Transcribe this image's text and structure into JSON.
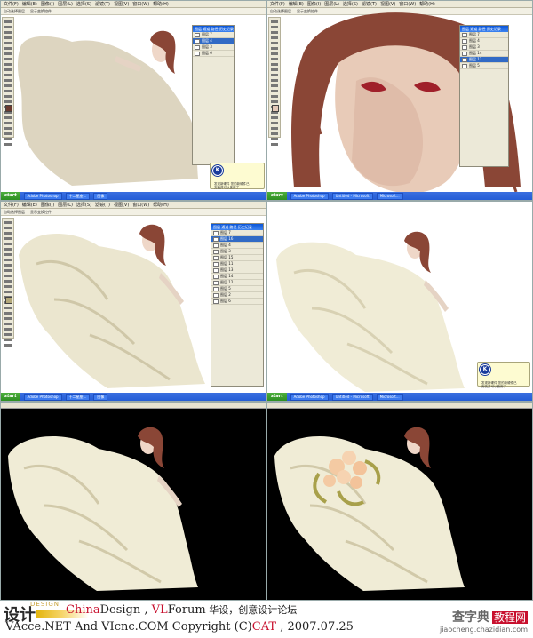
{
  "menus": [
    "文件(F)",
    "编辑(E)",
    "图像(I)",
    "图层(L)",
    "选择(S)",
    "滤镜(T)",
    "视图(V)",
    "窗口(W)",
    "帮助(H)"
  ],
  "options": [
    "自动选择图层",
    "显示变换控件"
  ],
  "taskbar": {
    "start": "start",
    "tasks_a": [
      "Adobe Photoshop",
      "十二星座...",
      "图像"
    ],
    "tasks_b": [
      "Adobe Photoshop",
      "Untitled - Microsoft",
      "Microsoft..."
    ]
  },
  "layers_top_left": {
    "title": "图层 通道 路径 历史记录",
    "rows": [
      "图层 7",
      "图层 4",
      "图层 3",
      "图层 6"
    ]
  },
  "layers_top_right": {
    "title": "图层 通道 路径 历史记录",
    "rows": [
      "图层 7",
      "图层 4",
      "图层 3",
      "图层 14",
      "图层 12",
      "图层 5"
    ]
  },
  "layers_mid_left": {
    "title": "图层 通道 路径 历史记录",
    "rows": [
      "图层 7",
      "图层 16",
      "图层 4",
      "图层 3",
      "图层 15",
      "图层 11",
      "图层 13",
      "图层 14",
      "图层 12",
      "图层 5",
      "图层 2",
      "图层 6"
    ]
  },
  "balloon_text": "发现新硬件 您的新硬件已安装并可以使用了",
  "balloon_knob": "K",
  "tab_label": "蓝鱼飞鸟 *.psd",
  "footer": {
    "line1": [
      "China",
      "Design",
      " , ",
      "VL",
      "Forum",
      "  华设，创意设计论坛"
    ],
    "line2": "VAcce.NET   And   VIcnc.COM   Copyright (C)",
    "cat": "CAT",
    "date": " , 2007.07.25",
    "watermark1": "查字典",
    "watermark2": "教程网",
    "watermark3": "jiaocheng.chazidian.com",
    "logo_text": "设计",
    "logo_word": "DESIGN"
  },
  "colors": {
    "hair": "#8a4636",
    "dress": "#f2efd9",
    "cream": "#ddd5c0",
    "dark_bg": "#000000"
  }
}
